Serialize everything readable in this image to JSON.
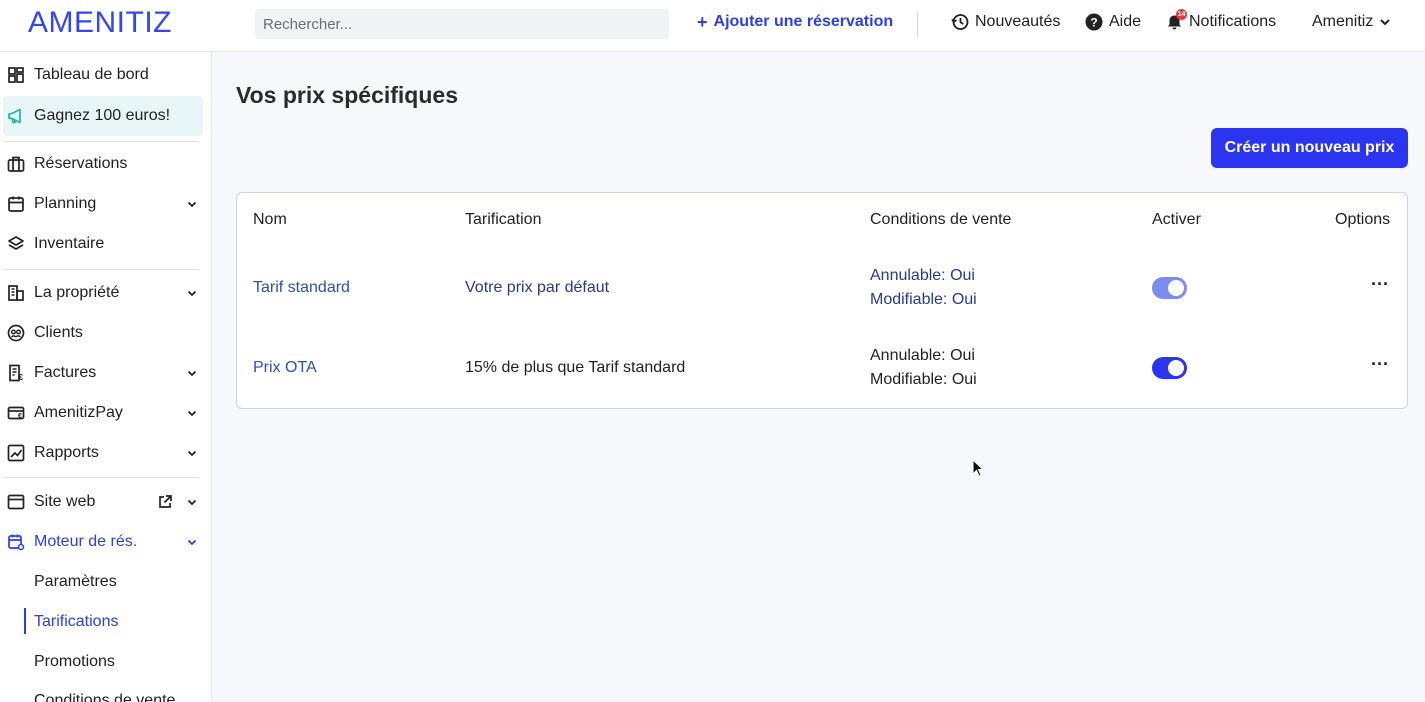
{
  "header": {
    "logo": "AMENITIZ",
    "search_placeholder": "Rechercher...",
    "add_reservation": "Ajouter une réservation",
    "news": "Nouveautés",
    "help": "Aide",
    "notifications": "Notifications",
    "notifications_badge": "14",
    "account": "Amenitiz"
  },
  "sidebar": {
    "items": [
      {
        "label": "Tableau de bord",
        "icon": "dashboard-icon"
      },
      {
        "label": "Gagnez 100 euros!",
        "icon": "megaphone-icon"
      },
      {
        "label": "Réservations",
        "icon": "briefcase-icon"
      },
      {
        "label": "Planning",
        "icon": "calendar-icon"
      },
      {
        "label": "Inventaire",
        "icon": "layers-icon"
      },
      {
        "label": "La propriété",
        "icon": "building-icon"
      },
      {
        "label": "Clients",
        "icon": "clients-icon"
      },
      {
        "label": "Factures",
        "icon": "invoice-icon"
      },
      {
        "label": "AmenitizPay",
        "icon": "card-icon"
      },
      {
        "label": "Rapports",
        "icon": "chart-icon"
      },
      {
        "label": "Site web",
        "icon": "browser-icon"
      },
      {
        "label": "Moteur de rés.",
        "icon": "calendar-settings-icon"
      }
    ],
    "subitems": [
      "Paramètres",
      "Tarifications",
      "Promotions",
      "Conditions de vente"
    ]
  },
  "main": {
    "title": "Vos prix spécifiques",
    "create_button": "Créer un nouveau prix",
    "table": {
      "columns": [
        "Nom",
        "Tarification",
        "Conditions de vente",
        "Activer",
        "Options"
      ],
      "rows": [
        {
          "name": "Tarif standard",
          "pricing": "Votre prix par défaut",
          "cond1": "Annulable: Oui",
          "cond2": "Modifiable: Oui",
          "active": true,
          "options": "···"
        },
        {
          "name": "Prix OTA",
          "pricing": "15% de plus que Tarif standard",
          "cond1": "Annulable: Oui",
          "cond2": "Modifiable: Oui",
          "active": true,
          "options": "···"
        }
      ]
    }
  },
  "colors": {
    "brand": "#3346ef",
    "primary_button": "#2b35ef",
    "link": "#2d4fb8"
  }
}
